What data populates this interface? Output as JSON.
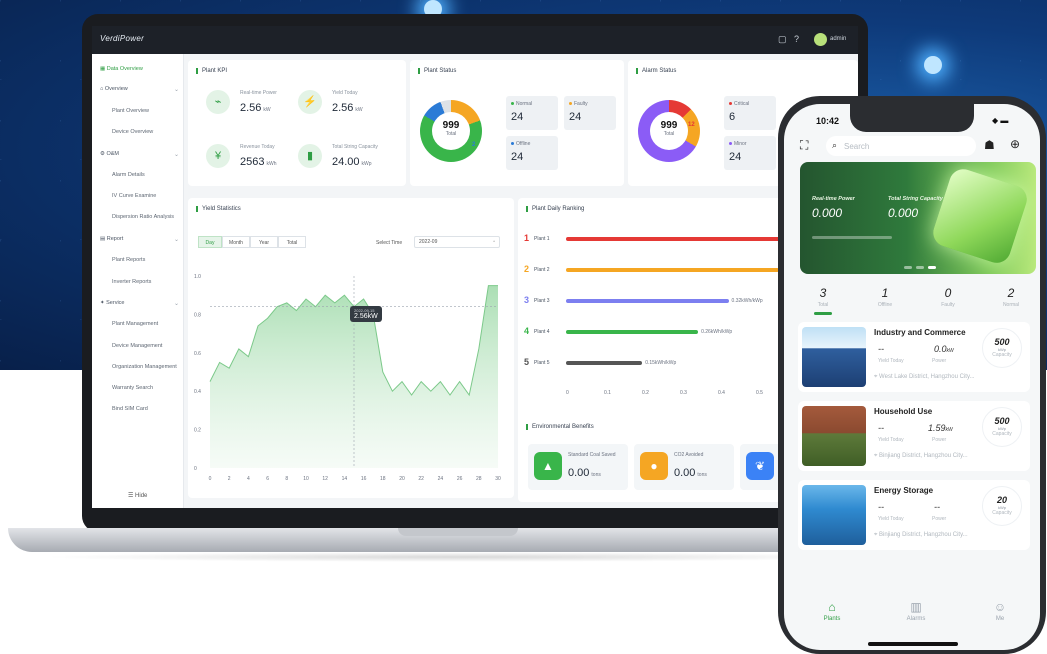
{
  "colors": {
    "accent": "#2f9e44",
    "orange": "#f5a623",
    "purple": "#8b5cf6",
    "red": "#e53935",
    "grey": "#555555"
  },
  "laptop": {
    "brand": "VerdiPower",
    "user": "admin",
    "topbar_icons": [
      "fullscreen-icon",
      "help-icon"
    ],
    "sidebar": {
      "items": [
        {
          "label": "Data Overview",
          "icon": "grid-icon",
          "active": true
        },
        {
          "label": "Overview",
          "icon": "home-icon",
          "expandable": true
        },
        {
          "label": "Plant Overview",
          "sub": true
        },
        {
          "label": "Device Overview",
          "sub": true
        },
        {
          "label": "O&M",
          "icon": "wrench-icon",
          "expandable": true
        },
        {
          "label": "Alarm Details",
          "sub": true
        },
        {
          "label": "IV Curve Examine",
          "sub": true
        },
        {
          "label": "Dispersion Ratio Analysis",
          "sub": true
        },
        {
          "label": "Report",
          "icon": "report-icon",
          "expandable": true
        },
        {
          "label": "Plant Reports",
          "sub": true
        },
        {
          "label": "Inverter Reports",
          "sub": true
        },
        {
          "label": "Service",
          "icon": "service-icon",
          "expandable": true
        },
        {
          "label": "Plant Management",
          "sub": true
        },
        {
          "label": "Device Management",
          "sub": true
        },
        {
          "label": "Organization Management",
          "sub": true
        },
        {
          "label": "Warranty Search",
          "sub": true
        },
        {
          "label": "Bind SIM Card",
          "sub": true
        }
      ],
      "footer": "Hide"
    },
    "plant_kpi": {
      "title": "Plant KPI",
      "items": [
        {
          "label": "Real-time Power",
          "value": "2.56",
          "unit": "kW",
          "icon": "tower-icon"
        },
        {
          "label": "Yield Today",
          "value": "2.56",
          "unit": "kW",
          "icon": "bolt-icon"
        },
        {
          "label": "Revenue Today",
          "value": "2563",
          "unit": "kWh",
          "icon": "yen-icon"
        },
        {
          "label": "Total String Capacity",
          "value": "24.00",
          "unit": "kWp",
          "icon": "battery-icon"
        }
      ]
    },
    "plant_status": {
      "title": "Plant Status",
      "total": "999",
      "total_label": "Total",
      "badge": "2",
      "items": [
        {
          "label": "Normal",
          "value": "24"
        },
        {
          "label": "Faulty",
          "value": "24"
        },
        {
          "label": "Offline",
          "value": "24"
        }
      ]
    },
    "alarm_status": {
      "title": "Alarm Status",
      "total": "999",
      "total_label": "Total",
      "badge": "12",
      "items": [
        {
          "label": "Critical",
          "value": "6"
        },
        {
          "label": "Minor",
          "value": "24"
        }
      ]
    },
    "yield_stats": {
      "title": "Yield Statistics",
      "tabs": [
        "Day",
        "Month",
        "Year",
        "Total"
      ],
      "select_label": "Select Time",
      "select_value": "2022-09",
      "tooltip_date": "2022-09-15",
      "tooltip_value": "2.56kW"
    },
    "ranking": {
      "title": "Plant Daily Ranking",
      "plants": [
        {
          "rank": "1",
          "name": "Plant 1",
          "value_label": ""
        },
        {
          "rank": "2",
          "name": "Plant 2",
          "value_label": "0.42kWh/kWp"
        },
        {
          "rank": "3",
          "name": "Plant 3",
          "value_label": "0.32kWh/kWp"
        },
        {
          "rank": "4",
          "name": "Plant 4",
          "value_label": "0.26kWh/kWp"
        },
        {
          "rank": "5",
          "name": "Plant 5",
          "value_label": "0.15kWh/kWp"
        }
      ],
      "axis_ticks": [
        "0",
        "0.1",
        "0.2",
        "0.3",
        "0.4",
        "0.5"
      ]
    },
    "env": {
      "title": "Environmental Benefits",
      "items": [
        {
          "label": "Standard Coal Saved",
          "value": "0.00",
          "unit": "tons",
          "icon": "coal-icon"
        },
        {
          "label": "CO2 Avoided",
          "value": "0.00",
          "unit": "tons",
          "icon": "co2-icon"
        },
        {
          "label": "",
          "value": "",
          "unit": "",
          "icon": "leaf-icon"
        }
      ]
    }
  },
  "phone": {
    "time": "10:42",
    "search_placeholder": "Search",
    "banner": {
      "power_label": "Real-time Power",
      "power_value": "0.000",
      "capacity_label": "Total String Capacity",
      "capacity_value": "0.000"
    },
    "stats": [
      {
        "value": "3",
        "label": "Total"
      },
      {
        "value": "1",
        "label": "Offline"
      },
      {
        "value": "0",
        "label": "Faulty"
      },
      {
        "value": "2",
        "label": "Normal"
      }
    ],
    "plants": [
      {
        "name": "Industry and Commerce",
        "yield": "--",
        "power": "0.0",
        "power_unit": "kW",
        "capacity": "500",
        "capacity_unit": "kWp",
        "yield_label": "Yield Today",
        "power_label": "Power",
        "capacity_label": "Capacity",
        "location": "West Lake District, Hangzhou City..."
      },
      {
        "name": "Household Use",
        "yield": "--",
        "power": "1.59",
        "power_unit": "kW",
        "capacity": "500",
        "capacity_unit": "kWp",
        "yield_label": "Yield Today",
        "power_label": "Power",
        "capacity_label": "Capacity",
        "location": "Binjiang District, Hangzhou City..."
      },
      {
        "name": "Energy Storage",
        "yield": "--",
        "power": "--",
        "power_unit": "",
        "capacity": "20",
        "capacity_unit": "kWp",
        "yield_label": "Yield Today",
        "power_label": "Power",
        "capacity_label": "Capacity",
        "location": "Binjiang District, Hangzhou City..."
      }
    ],
    "tabs": [
      {
        "label": "Plants",
        "icon": "plant-icon",
        "active": true
      },
      {
        "label": "Alarms",
        "icon": "alarm-icon"
      },
      {
        "label": "Me",
        "icon": "user-icon"
      }
    ]
  },
  "chart_data": {
    "type": "area",
    "title": "Yield Statistics",
    "x": [
      0,
      1,
      2,
      3,
      4,
      5,
      6,
      7,
      8,
      9,
      10,
      11,
      12,
      13,
      14,
      15,
      16,
      17,
      18,
      19,
      20,
      21,
      22,
      23,
      24,
      25,
      26,
      27,
      28,
      29,
      30
    ],
    "values": [
      0.45,
      0.55,
      0.52,
      0.62,
      0.58,
      0.74,
      0.78,
      0.84,
      0.86,
      0.82,
      0.88,
      0.84,
      0.9,
      0.86,
      0.9,
      0.84,
      0.88,
      0.8,
      0.5,
      0.4,
      0.45,
      0.38,
      0.45,
      0.4,
      0.45,
      0.38,
      0.45,
      0.38,
      0.62,
      0.95,
      0.95
    ],
    "xticks": [
      "0",
      "2",
      "4",
      "6",
      "8",
      "10",
      "12",
      "14",
      "16",
      "18",
      "20",
      "22",
      "24",
      "26",
      "28",
      "30"
    ],
    "yticks": [
      "1.0",
      "0.8",
      "0.6",
      "0.4",
      "0.2",
      "0"
    ],
    "ylim": [
      0,
      1.0
    ],
    "grid": false,
    "highlight_x": 15
  }
}
